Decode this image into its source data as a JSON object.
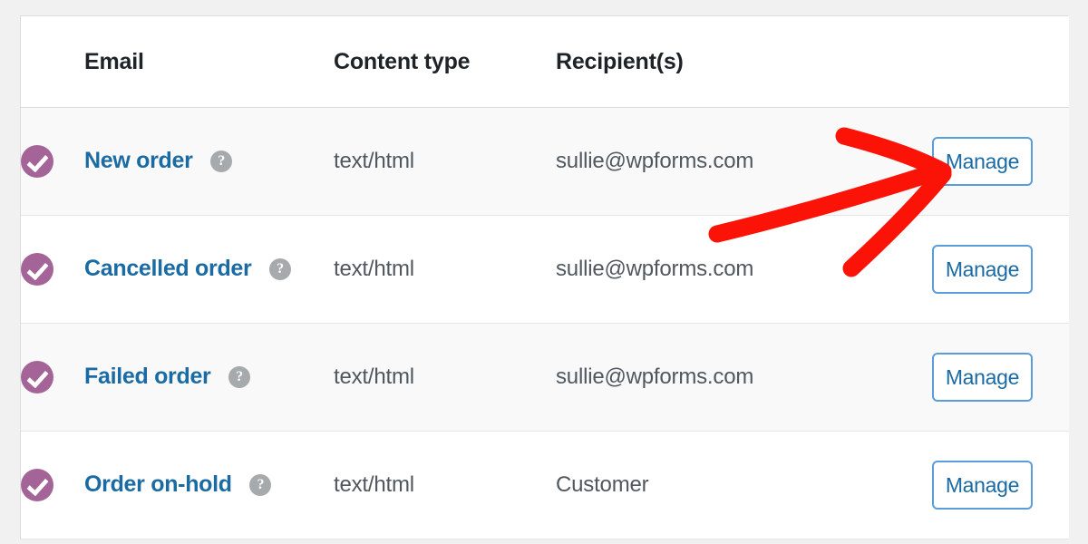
{
  "page": {
    "background_color": "#f1f1f1",
    "panel_background": "#ffffff"
  },
  "table": {
    "columns": [
      {
        "key": "status",
        "label": ""
      },
      {
        "key": "email",
        "label": "Email"
      },
      {
        "key": "type",
        "label": "Content type"
      },
      {
        "key": "recip",
        "label": "Recipient(s)"
      },
      {
        "key": "action",
        "label": ""
      }
    ],
    "headers": {
      "status": "",
      "email": "Email",
      "content_type": "Content type",
      "recipients": "Recipient(s)",
      "action": ""
    },
    "rows": [
      {
        "status_icon": "check-circle-icon",
        "enabled": true,
        "email": "New order",
        "help_icon": "?",
        "content_type": "text/html",
        "recipient": "sullie@wpforms.com",
        "action_label": "Manage",
        "striped": true
      },
      {
        "status_icon": "check-circle-icon",
        "enabled": true,
        "email": "Cancelled order",
        "help_icon": "?",
        "content_type": "text/html",
        "recipient": "sullie@wpforms.com",
        "action_label": "Manage",
        "striped": false
      },
      {
        "status_icon": "check-circle-icon",
        "enabled": true,
        "email": "Failed order",
        "help_icon": "?",
        "content_type": "text/html",
        "recipient": "sullie@wpforms.com",
        "action_label": "Manage",
        "striped": true
      },
      {
        "status_icon": "check-circle-icon",
        "enabled": true,
        "email": "Order on-hold",
        "help_icon": "?",
        "content_type": "text/html",
        "recipient": "Customer",
        "action_label": "Manage",
        "striped": false
      }
    ]
  },
  "colors": {
    "link": "#1a6ba3",
    "status_enabled": "#a46497",
    "help_icon": "#a7aaad",
    "button_border": "#5b9dd9",
    "annotation": "#fc1308",
    "header_text": "#1d2327",
    "body_text": "#50575e",
    "row_border": "#e6e6e8",
    "stripe": "#f9f9f9"
  },
  "annotation": {
    "type": "hand-drawn-arrow",
    "color": "#fc1308",
    "points_to": "Manage"
  }
}
